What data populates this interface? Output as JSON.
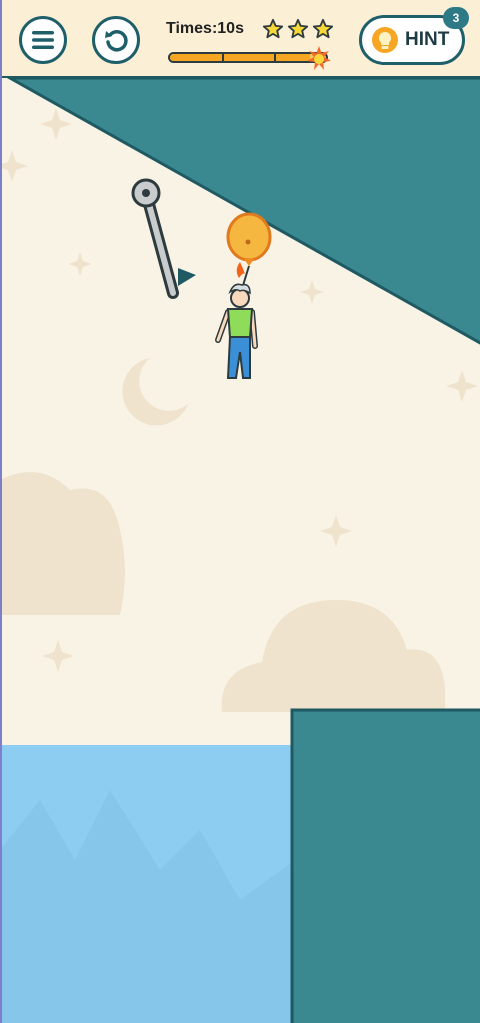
{
  "hud": {
    "timer_text": "Times:10s",
    "stars_total": 3,
    "stars_filled": 3,
    "time_progress": 0.9,
    "hint_label": "HINT",
    "hint_count": "3"
  },
  "icons": {
    "menu": "hamburger-menu-icon",
    "restart": "restart-arrow-icon",
    "star": "star-icon",
    "bomb": "bomb-icon",
    "hint": "lightbulb-icon"
  },
  "colors": {
    "sky": "#f9f3e5",
    "rock": "#3a8890",
    "rock_edge": "#1f5a63",
    "water": "#8dcdf1",
    "balloon": "#f6b741",
    "shirt": "#8fdc5a",
    "pants": "#3b8fd6"
  }
}
